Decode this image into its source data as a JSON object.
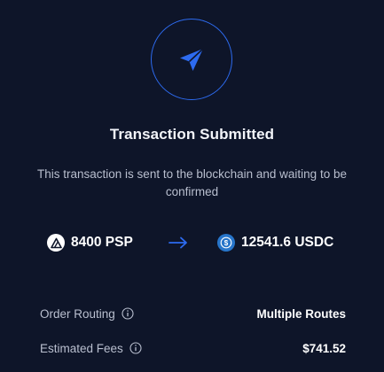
{
  "modal": {
    "status_icon": "paper-plane-icon",
    "title": "Transaction Submitted",
    "subtitle": "This transaction is sent to the blockchain and waiting to be confirmed"
  },
  "swap": {
    "from": {
      "amount": "8400",
      "symbol": "PSP",
      "icon": "psp-token-icon"
    },
    "arrow_icon": "arrow-right-icon",
    "to": {
      "amount": "12541.6",
      "symbol": "USDC",
      "icon": "usdc-token-icon"
    }
  },
  "details": [
    {
      "label": "Order Routing",
      "info_icon": "info-icon",
      "value": "Multiple Routes"
    },
    {
      "label": "Estimated Fees",
      "info_icon": "info-icon",
      "value": "$741.52"
    }
  ],
  "colors": {
    "background": "#0e1529",
    "accent": "#2d6bf0",
    "muted_text": "#b9bfcf",
    "usdc": "#2775ca"
  }
}
